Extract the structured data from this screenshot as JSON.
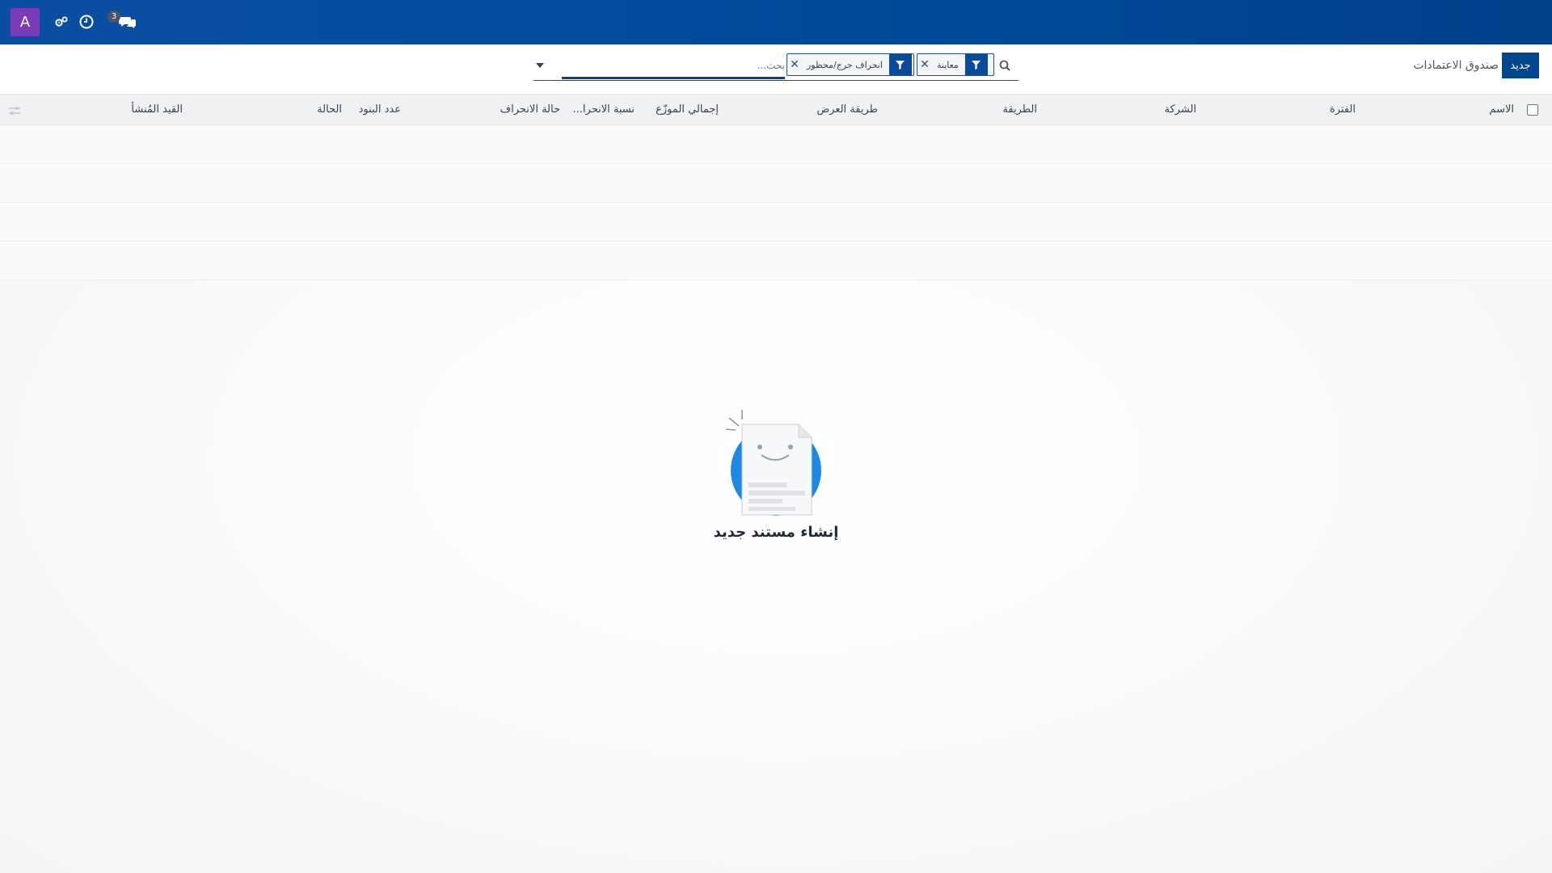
{
  "navbar": {
    "avatar_letter": "A",
    "messages_badge": "3",
    "icons": [
      "users-gear-icon",
      "clock-icon",
      "chat-icon"
    ]
  },
  "control_panel": {
    "new_button": "جديد",
    "breadcrumb": "صندوق الاعتمادات",
    "search": {
      "placeholder": "بحث...",
      "facets": [
        {
          "value": "معاينة"
        },
        {
          "value": "انحراف حرج/محظور"
        }
      ]
    }
  },
  "list": {
    "columns": [
      "الاسم",
      "الفترة",
      "الشركة",
      "الطريقة",
      "طريقة العرض",
      "إجمالي الموزّع",
      "نسبة الانحرا...",
      "حالة الانحراف",
      "عدد البنود",
      "الحالة",
      "القيد المُنشأ"
    ],
    "empty_rows": 4
  },
  "empty_state": {
    "title": "إنشاء مستند جديد"
  },
  "colors": {
    "navbar": "#004a99",
    "primary": "#00468c",
    "avatar": "#7b3bb8"
  }
}
